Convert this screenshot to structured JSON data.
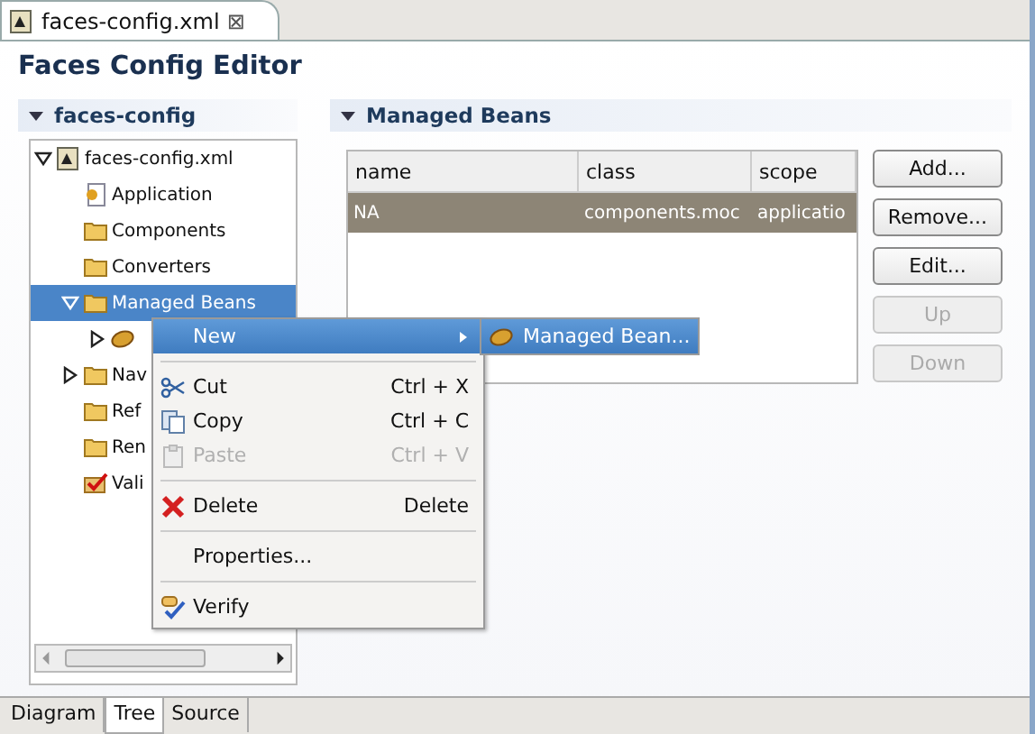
{
  "editor_tab": {
    "title": "faces-config.xml",
    "close": "⊠"
  },
  "title": "Faces Config Editor",
  "tree_section": {
    "title": "faces-config",
    "expanded": true,
    "tree": [
      {
        "label": "faces-config.xml",
        "kind": "file",
        "expanded": true,
        "selected": false,
        "children": [
          {
            "label": "Application",
            "kind": "page",
            "selected": false
          },
          {
            "label": "Components",
            "kind": "folder",
            "selected": false
          },
          {
            "label": "Converters",
            "kind": "folder",
            "selected": false
          },
          {
            "label": "Managed Beans",
            "kind": "folder",
            "expanded": true,
            "selected": true,
            "children": [
              {
                "kind": "bean",
                "expanded": false,
                "selected": false
              }
            ]
          },
          {
            "label": "Nav",
            "kind": "folder",
            "expanded": false,
            "selected": false
          },
          {
            "label": "Ref",
            "kind": "folder",
            "selected": false
          },
          {
            "label": "Ren",
            "kind": "folder",
            "selected": false
          },
          {
            "label": "Vali",
            "kind": "check",
            "selected": false
          }
        ]
      }
    ]
  },
  "beans_section": {
    "title": "Managed Beans",
    "expanded": true,
    "table": {
      "columns": [
        "name",
        "class",
        "scope"
      ],
      "rows": [
        {
          "cells": [
            "NA",
            "components.moc",
            "applicatio"
          ],
          "selected": true
        }
      ]
    },
    "buttons": [
      {
        "label": "Add...",
        "disabled": false
      },
      {
        "label": "Remove...",
        "disabled": false
      },
      {
        "label": "Edit...",
        "disabled": false
      },
      {
        "label": "Up",
        "disabled": true
      },
      {
        "label": "Down",
        "disabled": true
      }
    ]
  },
  "context_menu": [
    {
      "kind": "item",
      "label": "New",
      "highlighted": true,
      "submenu": true,
      "disabled": false
    },
    {
      "kind": "separator"
    },
    {
      "kind": "item",
      "label": "Cut",
      "shortcut": "Ctrl + X",
      "highlighted": false,
      "disabled": false
    },
    {
      "kind": "item",
      "label": "Copy",
      "shortcut": "Ctrl + C",
      "highlighted": false,
      "disabled": false
    },
    {
      "kind": "item",
      "label": "Paste",
      "shortcut": "Ctrl + V",
      "highlighted": false,
      "disabled": true
    },
    {
      "kind": "separator"
    },
    {
      "kind": "item",
      "label": "Delete",
      "shortcut": "Delete",
      "highlighted": false,
      "disabled": false
    },
    {
      "kind": "separator"
    },
    {
      "kind": "item",
      "label": "Properties...",
      "highlighted": false,
      "disabled": false
    },
    {
      "kind": "separator"
    },
    {
      "kind": "item",
      "label": "Verify",
      "highlighted": false,
      "disabled": false
    }
  ],
  "submenu": [
    {
      "label": "Managed Bean...",
      "highlighted": true
    }
  ],
  "bottom_tabs": [
    {
      "label": "Diagram",
      "selected": false
    },
    {
      "label": "Tree",
      "selected": true
    },
    {
      "label": "Source",
      "selected": false
    }
  ]
}
